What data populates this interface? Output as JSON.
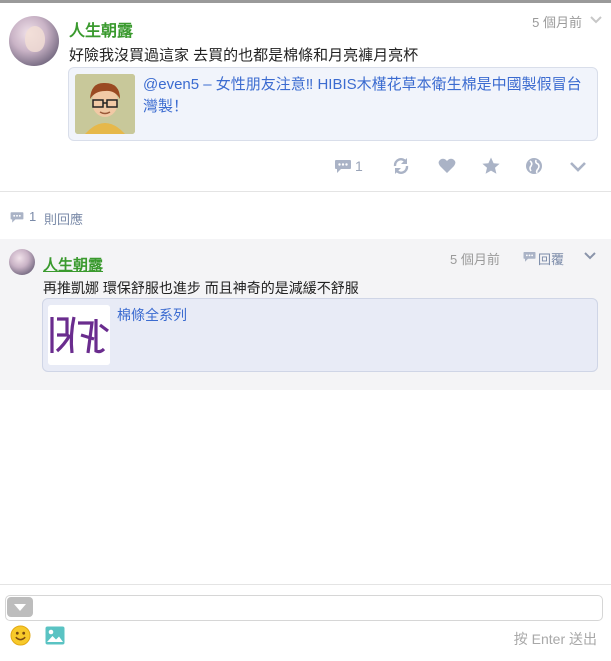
{
  "post": {
    "author": "人生朝露",
    "time": "5 個月前",
    "text": "好險我沒買過這家 去買的也都是棉條和月亮褲月亮杯",
    "link_card": {
      "text": "@even5 – 女性朋友注意‼ HIBIS木槿花草本衛生棉是中國製假冒台灣製！"
    },
    "actions": {
      "comment_count": "1"
    }
  },
  "replies_summary": {
    "count": "1",
    "label": "則回應"
  },
  "reply": {
    "author": "人生朝露",
    "time": "5 個月前",
    "reply_label": "回覆",
    "text": "再推凱娜 環保舒服也進步 而且神奇的是減緩不舒服",
    "link_card": {
      "text": "棉條全系列",
      "logo_text": "凱娜"
    }
  },
  "composer": {
    "placeholder": "",
    "send_hint": "按 Enter 送出"
  },
  "colors": {
    "author_green": "#3a9a2e",
    "link_blue": "#3b6bd0",
    "icon_gray": "#9aa4b8",
    "logo_purple": "#6a2c8e"
  },
  "icons": [
    "comment-icon",
    "share-icon",
    "heart-icon",
    "star-icon",
    "globe-icon",
    "chevron-down-icon",
    "reply-icon",
    "expand-icon",
    "emoji-icon",
    "image-icon"
  ]
}
